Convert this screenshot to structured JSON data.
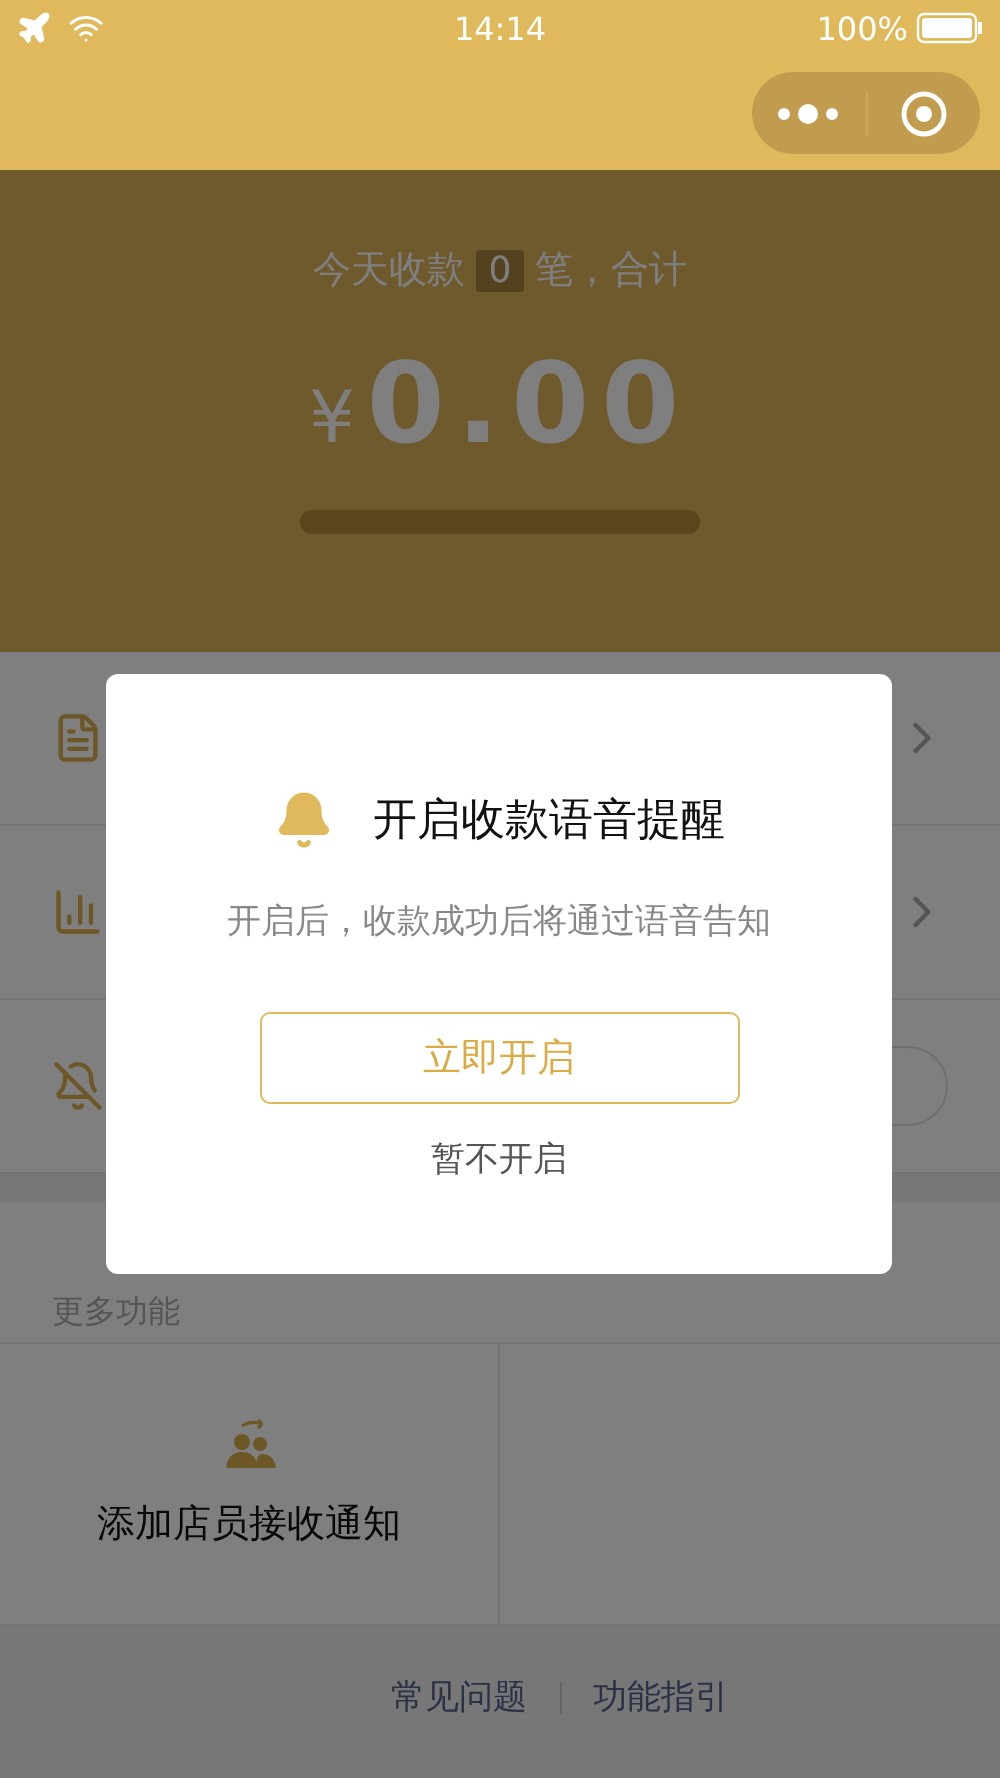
{
  "status_bar": {
    "time": "14:14",
    "battery": "100%"
  },
  "summary": {
    "prefix": "今天收款",
    "count": "0",
    "suffix": "笔，合计",
    "currency": "¥",
    "amount": "0.00"
  },
  "menu_rows": [
    {
      "kind": "document"
    },
    {
      "kind": "chart"
    },
    {
      "kind": "toggle",
      "on": false
    }
  ],
  "more": {
    "title": "更多功能",
    "items": [
      {
        "label": "添加店员接收通知"
      }
    ]
  },
  "footer_links": [
    "常见问题",
    "功能指引"
  ],
  "dialog": {
    "title": "开启收款语音提醒",
    "message": "开启后，收款成功后将通过语音告知",
    "confirm": "立即开启",
    "cancel": "暂不开启"
  }
}
